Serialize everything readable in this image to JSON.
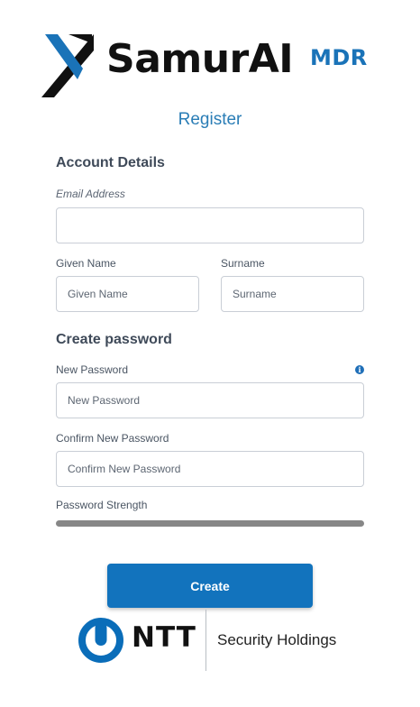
{
  "brand": {
    "name": "SamurAI",
    "suffix": "MDR",
    "accent_color": "#1a73b8"
  },
  "page": {
    "title": "Register"
  },
  "account_details": {
    "heading": "Account Details",
    "email": {
      "label": "Email Address",
      "value": "",
      "placeholder": ""
    },
    "given_name": {
      "label": "Given Name",
      "value": "",
      "placeholder": "Given Name"
    },
    "surname": {
      "label": "Surname",
      "value": "",
      "placeholder": "Surname"
    }
  },
  "password": {
    "heading": "Create password",
    "new": {
      "label": "New Password",
      "value": "",
      "placeholder": "New Password",
      "info_icon": "info-icon"
    },
    "confirm": {
      "label": "Confirm New Password",
      "value": "",
      "placeholder": "Confirm New Password"
    },
    "strength": {
      "label": "Password Strength",
      "level": 0,
      "bar_color": "#878787"
    }
  },
  "actions": {
    "create_label": "Create",
    "button_color": "#1273bd"
  },
  "footer": {
    "company_mark": "NTT",
    "company_sub": "Security Holdings",
    "mark_color": "#0a6db9"
  }
}
